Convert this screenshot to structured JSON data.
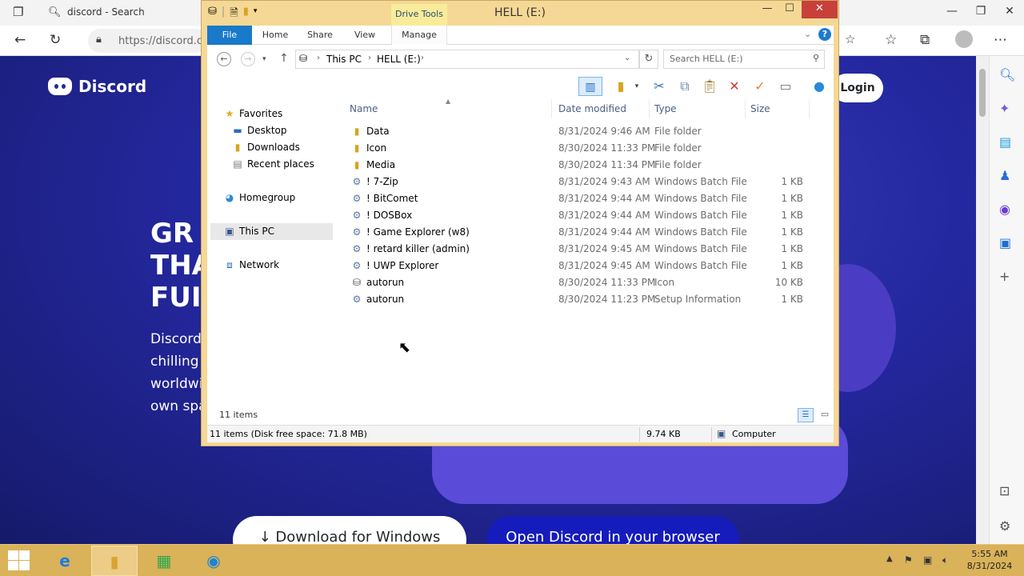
{
  "browser": {
    "tab_title": "discord - Search",
    "address": "https://discord.c",
    "discord": {
      "brand": "Discord",
      "login": "Login",
      "hero_title_lines": [
        "GR",
        "THA",
        "FUI"
      ],
      "hero_desc_lines": [
        "Discord",
        "chilling",
        "worldwi",
        "own spa"
      ],
      "download_label": "Download for Windows",
      "open_browser_label": "Open Discord in your browser"
    }
  },
  "explorer": {
    "title": "HELL (E:)",
    "context_tab": "Drive Tools",
    "ribbon_tabs": {
      "file": "File",
      "home": "Home",
      "share": "Share",
      "view": "View",
      "manage": "Manage"
    },
    "breadcrumb": [
      "This PC",
      "HELL (E:)"
    ],
    "search_placeholder": "Search HELL (E:)",
    "nav_pane": {
      "favorites": "Favorites",
      "desktop": "Desktop",
      "downloads": "Downloads",
      "recent": "Recent places",
      "homegroup": "Homegroup",
      "this_pc": "This PC",
      "network": "Network"
    },
    "columns": {
      "name": "Name",
      "date": "Date modified",
      "type": "Type",
      "size": "Size"
    },
    "files": [
      {
        "icon": "folder-icon",
        "name": "Data",
        "date": "8/31/2024 9:46 AM",
        "type": "File folder",
        "size": ""
      },
      {
        "icon": "folder-icon",
        "name": "Icon",
        "date": "8/30/2024 11:33 PM",
        "type": "File folder",
        "size": ""
      },
      {
        "icon": "folder-icon",
        "name": "Media",
        "date": "8/30/2024 11:34 PM",
        "type": "File folder",
        "size": ""
      },
      {
        "icon": "batch-file-icon",
        "name": "! 7-Zip",
        "date": "8/31/2024 9:43 AM",
        "type": "Windows Batch File",
        "size": "1 KB"
      },
      {
        "icon": "batch-file-icon",
        "name": "! BitComet",
        "date": "8/31/2024 9:44 AM",
        "type": "Windows Batch File",
        "size": "1 KB"
      },
      {
        "icon": "batch-file-icon",
        "name": "! DOSBox",
        "date": "8/31/2024 9:44 AM",
        "type": "Windows Batch File",
        "size": "1 KB"
      },
      {
        "icon": "batch-file-icon",
        "name": "! Game Explorer (w8)",
        "date": "8/31/2024 9:44 AM",
        "type": "Windows Batch File",
        "size": "1 KB"
      },
      {
        "icon": "batch-file-icon",
        "name": "! retard killer (admin)",
        "date": "8/31/2024 9:45 AM",
        "type": "Windows Batch File",
        "size": "1 KB"
      },
      {
        "icon": "batch-file-icon",
        "name": "! UWP Explorer",
        "date": "8/31/2024 9:45 AM",
        "type": "Windows Batch File",
        "size": "1 KB"
      },
      {
        "icon": "drive-icon-file-icon",
        "name": "autorun",
        "date": "8/30/2024 11:33 PM",
        "type": "Icon",
        "size": "10 KB"
      },
      {
        "icon": "setup-info-icon",
        "name": "autorun",
        "date": "8/30/2024 11:23 PM",
        "type": "Setup Information",
        "size": "1 KB"
      }
    ],
    "item_count": "11 items",
    "status": {
      "main": "11 items (Disk free space: 71.8 MB)",
      "size": "9.74 KB",
      "location": "Computer"
    }
  },
  "taskbar": {
    "time": "5:55 AM",
    "date": "8/31/2024"
  },
  "colors": {
    "window_frame": "#f5d895",
    "taskbar": "#d9b25a",
    "file_tab": "#1979ca",
    "close_button": "#c7403a",
    "discord_blurple": "#2428a0"
  }
}
